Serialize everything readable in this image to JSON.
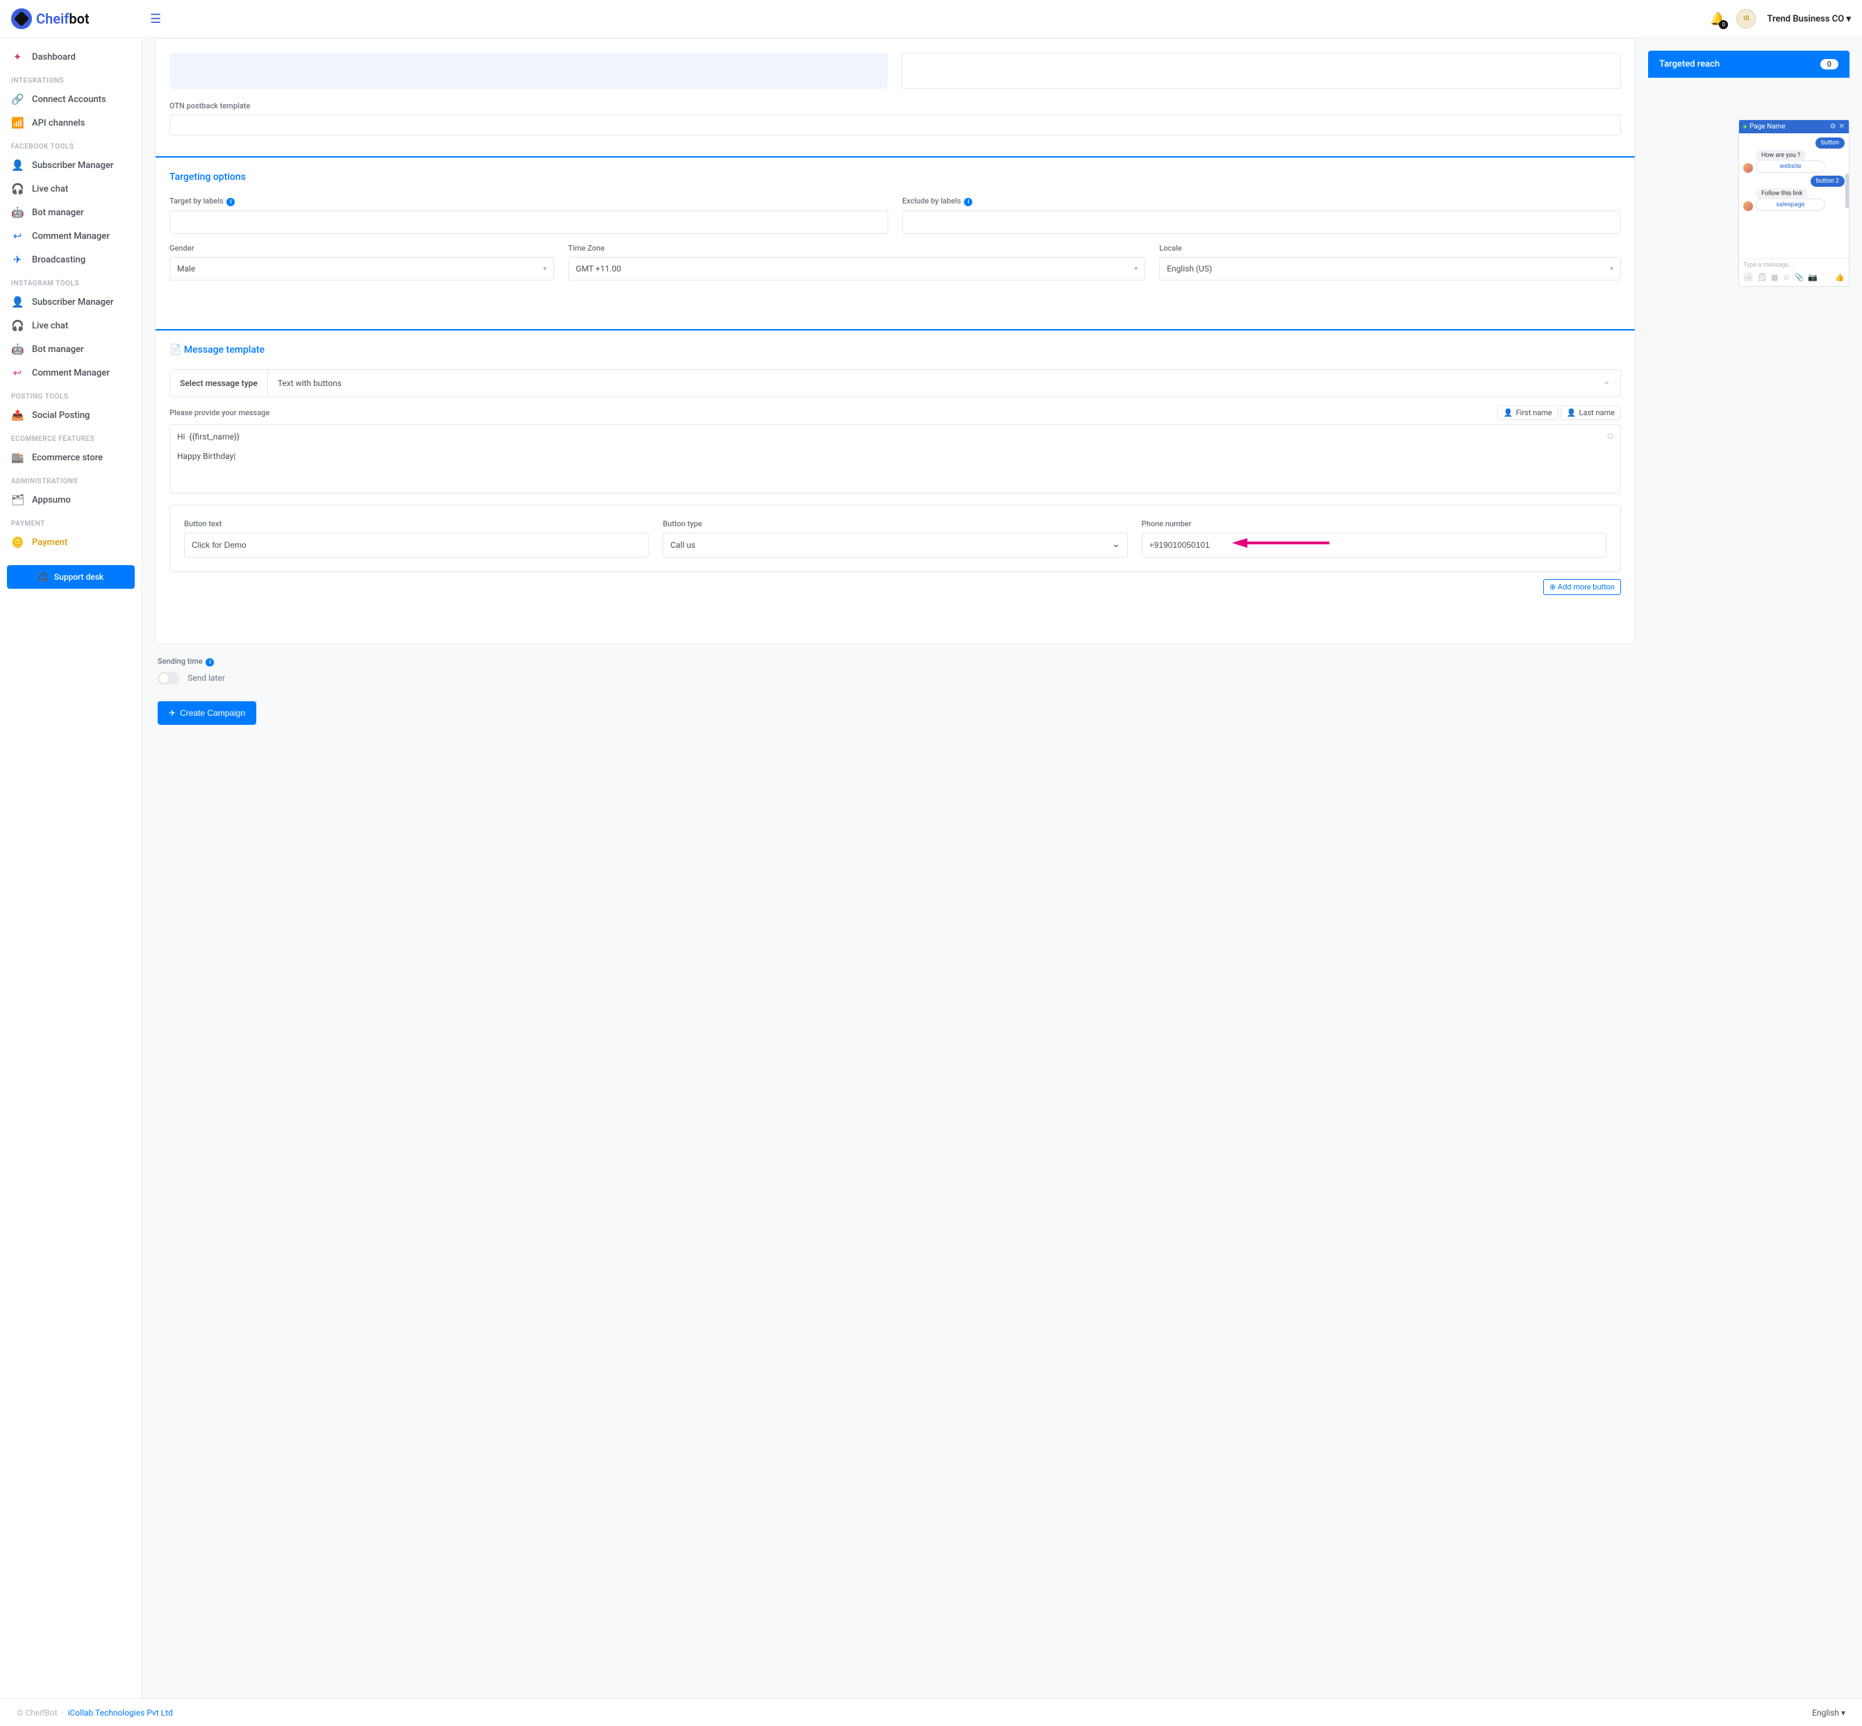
{
  "header": {
    "brand_part1": "Cheif",
    "brand_part2": "bot",
    "bell_count": "0",
    "org_name": "Trend Business CO"
  },
  "sidebar": {
    "dashboard": "Dashboard",
    "sec_integrations": "INTEGRATIONS",
    "connect_accounts": "Connect Accounts",
    "api_channels": "API channels",
    "sec_fb": "FACEBOOK TOOLS",
    "fb_subscriber": "Subscriber Manager",
    "fb_livechat": "Live chat",
    "fb_bot": "Bot manager",
    "fb_comment": "Comment Manager",
    "fb_broadcast": "Broadcasting",
    "sec_ig": "INSTAGRAM TOOLS",
    "ig_subscriber": "Subscriber Manager",
    "ig_livechat": "Live chat",
    "ig_bot": "Bot manager",
    "ig_comment": "Comment Manager",
    "sec_posting": "POSTING TOOLS",
    "social_posting": "Social Posting",
    "sec_ecom": "ECOMMERCE FEATURES",
    "ecom_store": "Ecommerce store",
    "sec_admin": "ADMINISTRATIONS",
    "appsumo": "Appsumo",
    "sec_pay": "PAYMENT",
    "payment": "Payment",
    "support": "Support desk"
  },
  "form": {
    "otn_label": "OTN postback template",
    "targeting_title": "Targeting options",
    "target_labels": "Target by labels",
    "exclude_labels": "Exclude by labels",
    "gender_label": "Gender",
    "gender_value": "Male",
    "timezone_label": "Time Zone",
    "timezone_value": "GMT +11.00",
    "locale_label": "Locale",
    "locale_value": "English (US)",
    "msg_template_title": "Message template",
    "select_msg_type": "Select message type",
    "msg_type_value": "Text with buttons",
    "provide_msg": "Please provide your message",
    "first_name_btn": "First name",
    "last_name_btn": "Last name",
    "message_text": "Hi  {{first_name}}\n\nHappy Birthday|",
    "button_text_label": "Button text",
    "button_text_value": "Click for Demo",
    "button_type_label": "Button type",
    "button_type_value": "Call us",
    "phone_label": "Phone number",
    "phone_value": "+919010050101",
    "add_more": "Add more button",
    "sending_time": "Sending time",
    "send_later": "Send later",
    "create_campaign": "Create Campaign"
  },
  "right": {
    "targeted_reach": "Targeted reach",
    "targeted_count": "0",
    "chat": {
      "page_name": "Page Name",
      "button": "button",
      "how_are_you": "How are you ?",
      "website": "website",
      "button2": "button 2",
      "follow_link": "Follow this link",
      "salespage": "salespage",
      "type_msg": "Type a message..."
    }
  },
  "footer": {
    "copyright": "© CheifBot",
    "sep": "·",
    "company": "iCollab Technologies Pvt Ltd",
    "lang": "English"
  }
}
